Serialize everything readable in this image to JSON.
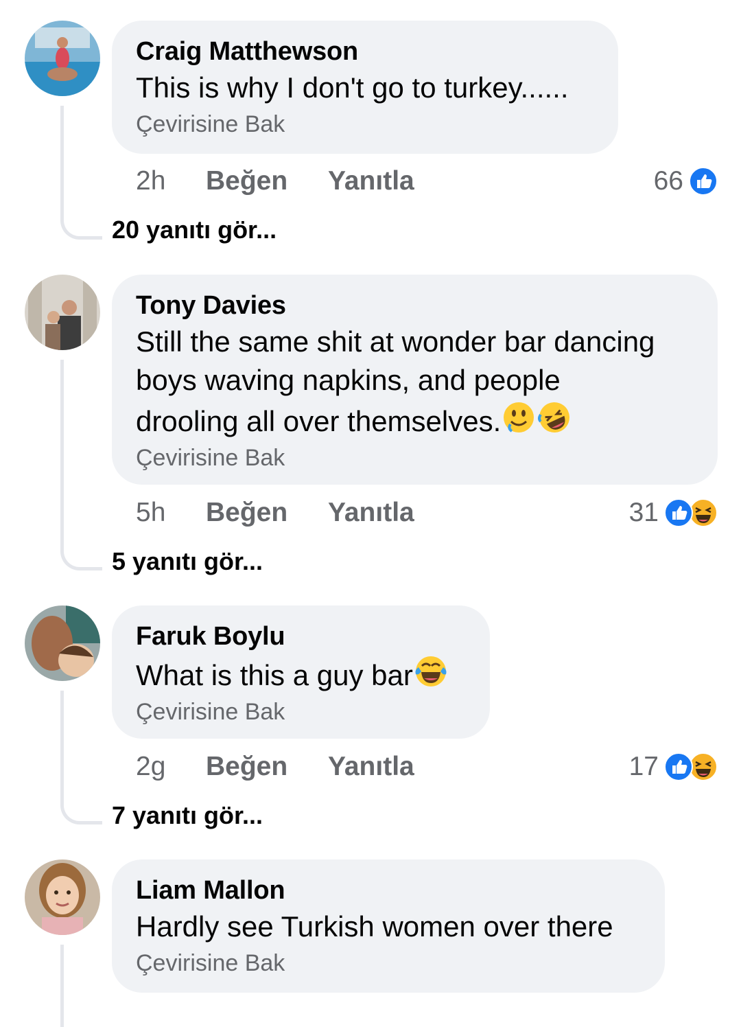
{
  "translate_label": "Çevirisine Bak",
  "like_label": "Beğen",
  "reply_label": "Yanıtla",
  "comments": [
    {
      "author": "Craig Matthewson",
      "text": "This is why I don't go to turkey......",
      "time": "2h",
      "reaction_count": "66",
      "reactions": [
        "like-icon"
      ],
      "replies": "20 yanıtı gör..."
    },
    {
      "author": "Tony Davies",
      "text_lines": [
        "Still the same shit at wonder bar dancing",
        "boys waving napkins, and people",
        "drooling all over themselves."
      ],
      "text_emojis": [
        "drooling-face-emoji",
        "rolling-on-floor-laughing-emoji"
      ],
      "time": "5h",
      "reaction_count": "31",
      "reactions": [
        "like-icon",
        "haha-icon"
      ],
      "replies": "5 yanıtı gör..."
    },
    {
      "author": "Faruk Boylu",
      "text": "What is this a guy bar",
      "text_emojis": [
        "tears-of-joy-emoji"
      ],
      "time": "2g",
      "reaction_count": "17",
      "reactions": [
        "like-icon",
        "haha-icon"
      ],
      "replies": "7 yanıtı gör..."
    },
    {
      "author": "Liam Mallon",
      "text": "Hardly see Turkish women over there"
    }
  ],
  "colors": {
    "bubble": "#f0f2f5",
    "secondary_text": "#65676b",
    "like_blue": "#1877f2",
    "haha_yellow": "#f7b125"
  }
}
